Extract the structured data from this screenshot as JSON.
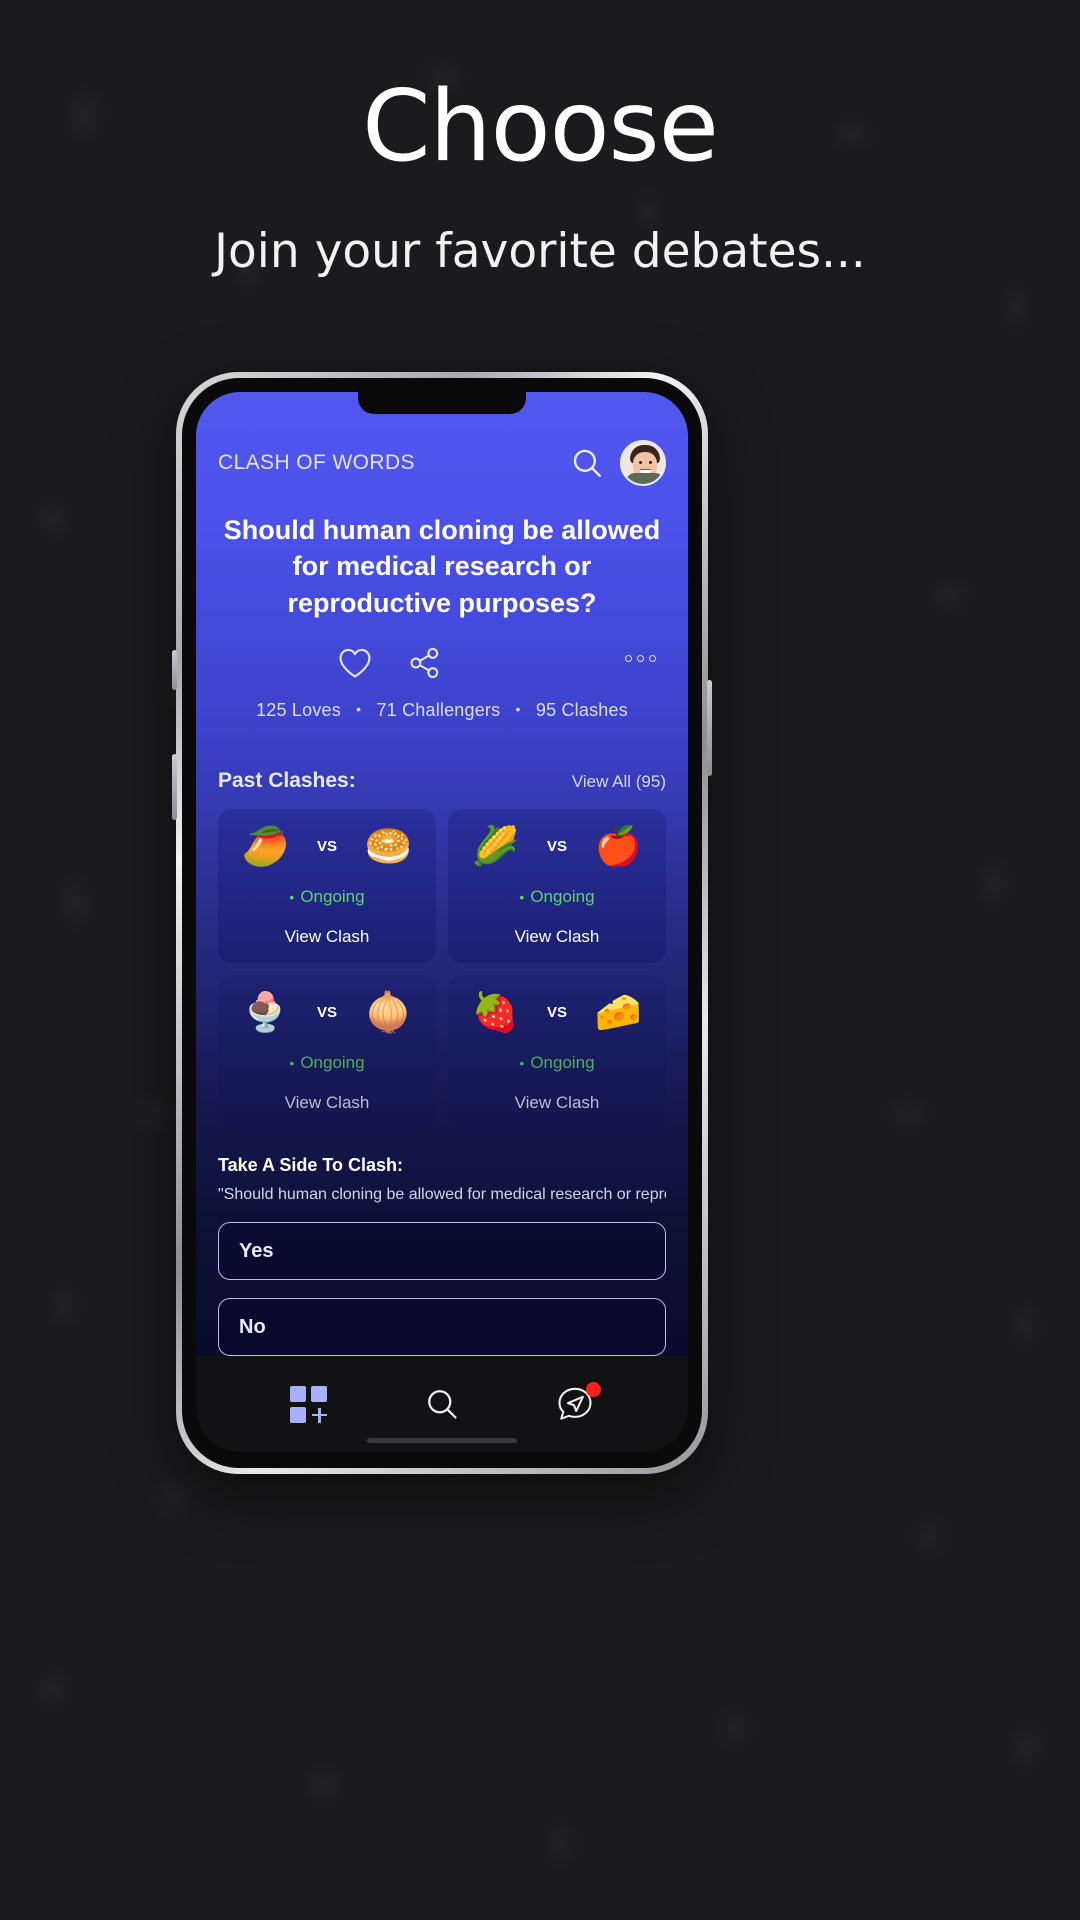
{
  "promo": {
    "title": "Choose",
    "subtitle": "Join your favorite debates..."
  },
  "app": {
    "brand": "CLASH OF WORDS",
    "icons": {
      "search": "search-icon",
      "avatar": "avatar",
      "love": "heart-icon",
      "share": "share-icon",
      "more": "more-options-icon"
    },
    "question": "Should human cloning be allowed for medical research or reproductive purposes?",
    "stats": {
      "loves": "125 Loves",
      "challengers": "71 Challengers",
      "clashes": "95 Clashes",
      "separator": "•"
    },
    "past_clashes": {
      "title": "Past Clashes:",
      "view_all": "View All (95)",
      "cards": [
        {
          "left_emoji": "🥭",
          "vs": "VS",
          "right_emoji": "🥯",
          "status": "Ongoing",
          "status_dot": "•",
          "action": "View Clash"
        },
        {
          "left_emoji": "🌽",
          "vs": "VS",
          "right_emoji": "🍎",
          "status": "Ongoing",
          "status_dot": "•",
          "action": "View Clash"
        },
        {
          "left_emoji": "🍨",
          "vs": "VS",
          "right_emoji": "🧅",
          "status": "Ongoing",
          "status_dot": "•",
          "action": "View Clash"
        },
        {
          "left_emoji": "🍓",
          "vs": "VS",
          "right_emoji": "🧀",
          "status": "Ongoing",
          "status_dot": "•",
          "action": "View Clash"
        }
      ]
    },
    "take_side": {
      "title": "Take A Side To Clash:",
      "quote": "\"Should human cloning be allowed for medical research or reprod...",
      "options": [
        {
          "label": "Yes"
        },
        {
          "label": "No"
        }
      ]
    },
    "bottom_nav": {
      "items": [
        {
          "name": "create",
          "icon": "grid-plus-icon"
        },
        {
          "name": "search",
          "icon": "search-icon"
        },
        {
          "name": "messages",
          "icon": "send-message-icon",
          "badge": true
        }
      ]
    }
  },
  "colors": {
    "accent_blue": "#5257f0",
    "deep_navy": "#0a0c2c",
    "status_green": "#5fd36a",
    "badge_red": "#ff1f1f",
    "icon_lavender": "#a9b0fb"
  }
}
